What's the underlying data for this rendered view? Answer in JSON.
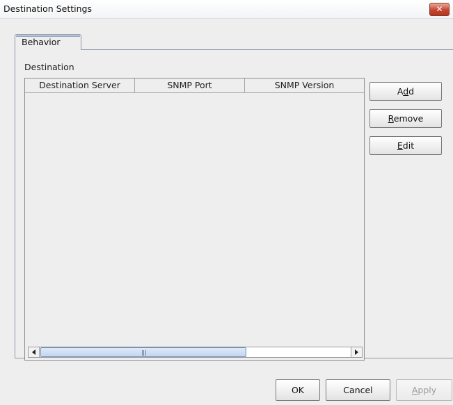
{
  "window": {
    "title": "Destination Settings",
    "close_glyph": "✕"
  },
  "tabs": [
    {
      "label": "Behavior",
      "selected": true
    }
  ],
  "group": {
    "label": "Destination"
  },
  "table": {
    "columns": [
      "Destination Server",
      "SNMP Port",
      "SNMP Version"
    ],
    "rows": []
  },
  "side_buttons": {
    "add": {
      "pre": "A",
      "mnemonic": "d",
      "post": "d"
    },
    "remove": {
      "pre": "",
      "mnemonic": "R",
      "post": "emove"
    },
    "edit": {
      "pre": "",
      "mnemonic": "E",
      "post": "dit"
    }
  },
  "footer": {
    "ok": "OK",
    "cancel": "Cancel",
    "apply": {
      "pre": "",
      "mnemonic": "A",
      "post": "pply",
      "enabled": false
    }
  },
  "icons": {
    "close": "close-icon",
    "scroll_left": "arrow-left-icon",
    "scroll_right": "arrow-right-icon"
  },
  "colors": {
    "close_button": "#c7452f",
    "scroll_thumb": "#c4d5ee",
    "tab_accent": "#95a7c4"
  }
}
